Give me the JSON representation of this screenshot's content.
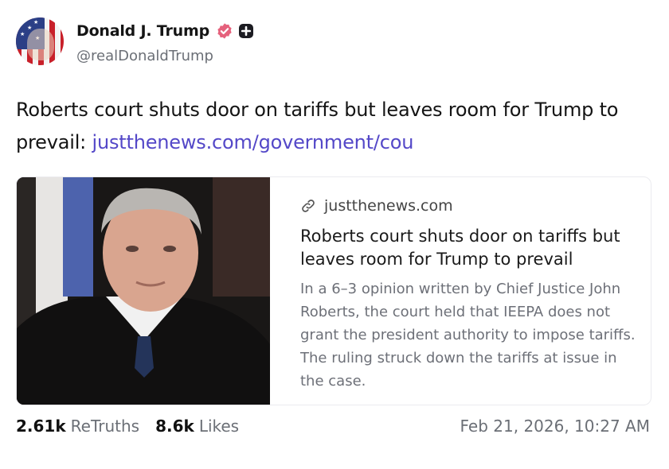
{
  "post": {
    "author": {
      "display_name": "Donald J. Trump",
      "handle": "@realDonaldTrump",
      "verified_color": "#e5617c"
    },
    "text": "Roberts court shuts door on tariffs but leaves room for Trump to prevail: ",
    "link_text": "justthenews.com/government/cou",
    "link_color": "#5448c8",
    "card": {
      "domain": "justthenews.com",
      "title": "Roberts court shuts door on tariffs but leaves room for Trump to prevail",
      "description": "In a 6–3 opinion written by Chief Justice John Roberts, the court held that IEEPA does not grant the president authority to impose tariffs. The ruling struck down the tariffs at issue in the case."
    },
    "stats": {
      "retruths_count": "2.61k",
      "retruths_label": "ReTruths",
      "likes_count": "8.6k",
      "likes_label": "Likes"
    },
    "timestamp": "Feb 21, 2026, 10:27 AM"
  }
}
